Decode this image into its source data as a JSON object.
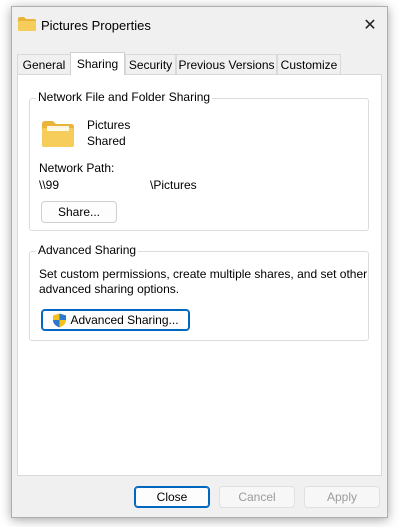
{
  "window": {
    "title": "Pictures Properties",
    "close_glyph": "✕"
  },
  "tabs": [
    {
      "label": "General"
    },
    {
      "label": "Sharing",
      "active": true
    },
    {
      "label": "Security"
    },
    {
      "label": "Previous Versions"
    },
    {
      "label": "Customize"
    }
  ],
  "network_sharing": {
    "group_title": "Network File and Folder Sharing",
    "folder_name": "Pictures",
    "share_status": "Shared",
    "path_label": "Network Path:",
    "path_host": "\\\\99",
    "path_share": "\\Pictures",
    "share_button": "Share..."
  },
  "advanced_sharing": {
    "group_title": "Advanced Sharing",
    "description_line1": "Set custom permissions, create multiple shares, and set other",
    "description_line2": "advanced sharing options.",
    "button_label": "Advanced Sharing..."
  },
  "footer": {
    "close": "Close",
    "cancel": "Cancel",
    "apply": "Apply"
  },
  "colors": {
    "folder": "#e8b53a",
    "accent": "#0067c0",
    "shield_blue": "#2b78d1",
    "shield_yellow": "#f2c11b"
  }
}
